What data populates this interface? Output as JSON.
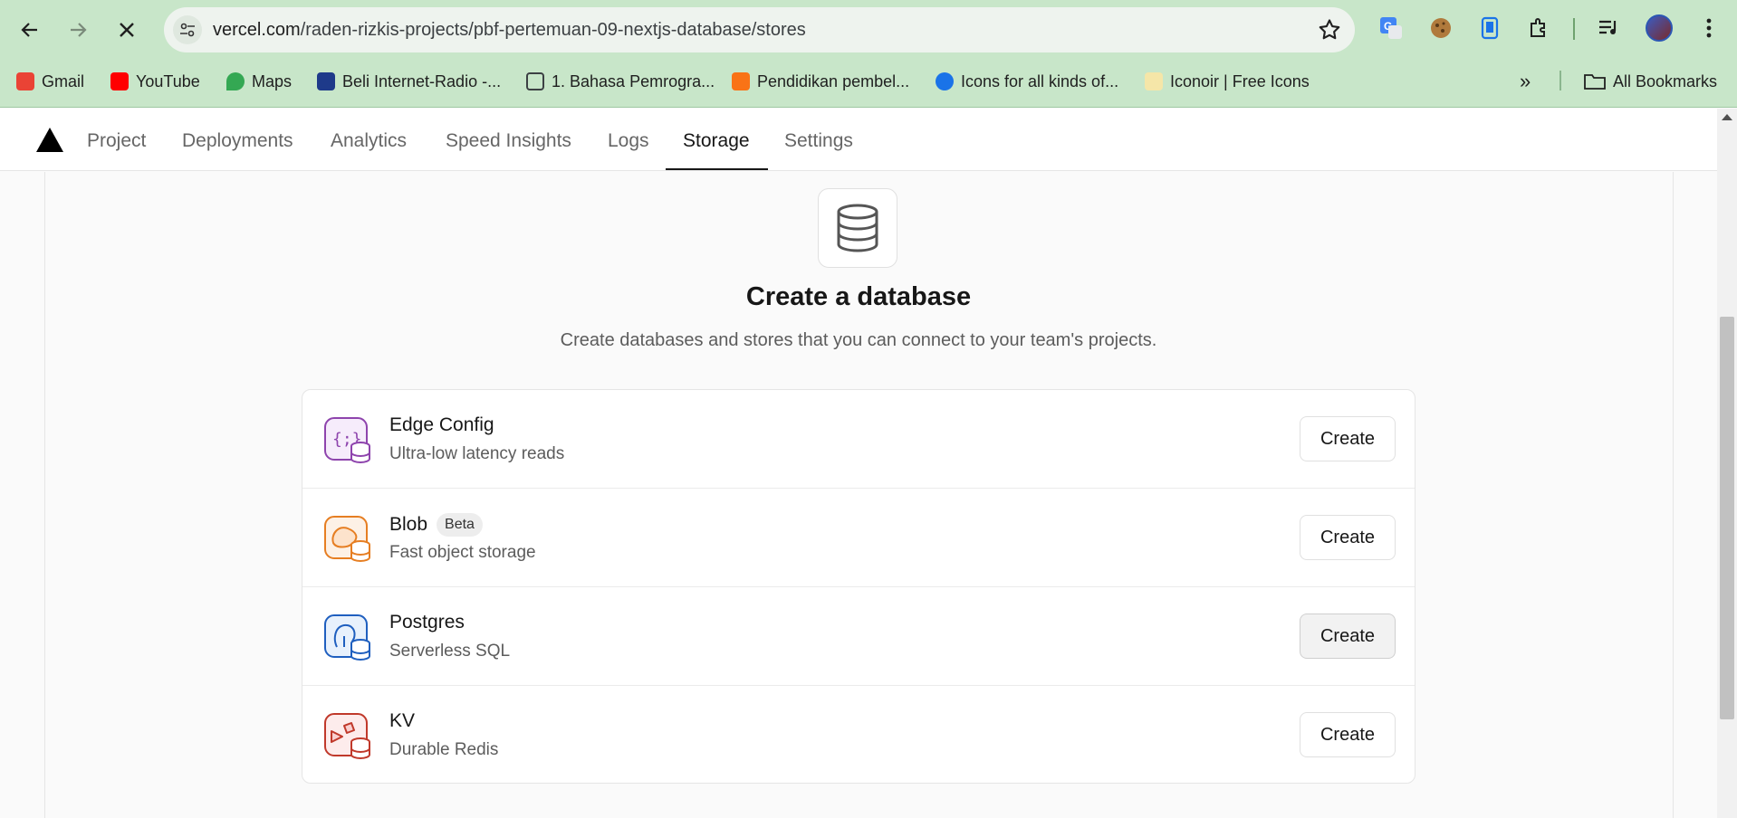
{
  "browser": {
    "url_host": "vercel.com",
    "url_path": "/raden-rizkis-projects/pbf-pertemuan-09-nextjs-database/stores",
    "bookmarks": [
      {
        "label": "Gmail",
        "color": "#ea4335"
      },
      {
        "label": "YouTube",
        "color": "#ff0000"
      },
      {
        "label": "Maps",
        "color": "#34a853"
      },
      {
        "label": "Beli Internet-Radio -...",
        "color": "#1e3a8a"
      },
      {
        "label": "1. Bahasa Pemrogra...",
        "color": "#3c4043"
      },
      {
        "label": "Pendidikan pembel...",
        "color": "#f97316"
      },
      {
        "label": "Icons for all kinds of...",
        "color": "#1a73e8"
      },
      {
        "label": "Iconoir | Free Icons",
        "color": "#f5e6a8"
      }
    ],
    "all_bookmarks": "All Bookmarks"
  },
  "nav": {
    "tabs": [
      "Project",
      "Deployments",
      "Analytics",
      "Speed Insights",
      "Logs",
      "Storage",
      "Settings"
    ],
    "active_tab": "Storage"
  },
  "header": {
    "title": "Create a database",
    "subtitle": "Create databases and stores that you can connect to your team's projects."
  },
  "stores": [
    {
      "name": "Edge Config",
      "badge": "",
      "description": "Ultra-low latency reads",
      "button": "Create",
      "color": "#8e44ad"
    },
    {
      "name": "Blob",
      "badge": "Beta",
      "description": "Fast object storage",
      "button": "Create",
      "color": "#e67e22"
    },
    {
      "name": "Postgres",
      "badge": "",
      "description": "Serverless SQL",
      "button": "Create",
      "color": "#1f5fbf"
    },
    {
      "name": "KV",
      "badge": "",
      "description": "Durable Redis",
      "button": "Create",
      "color": "#c0392b"
    }
  ]
}
